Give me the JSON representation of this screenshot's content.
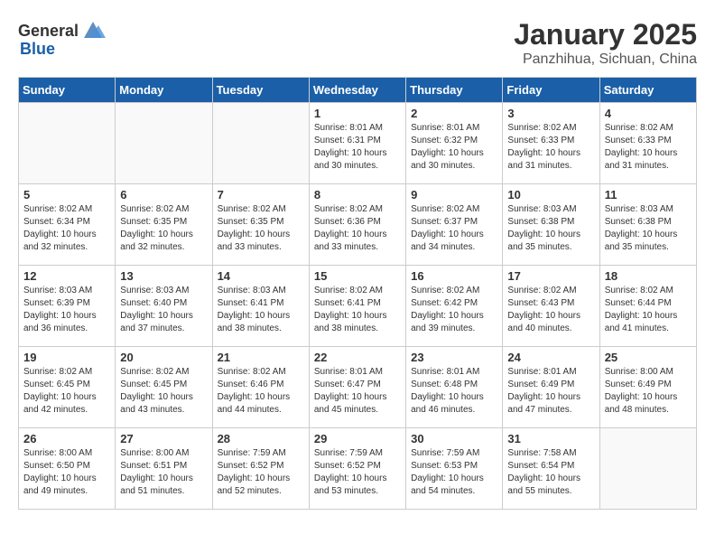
{
  "header": {
    "logo_general": "General",
    "logo_blue": "Blue",
    "title": "January 2025",
    "subtitle": "Panzhihua, Sichuan, China"
  },
  "weekdays": [
    "Sunday",
    "Monday",
    "Tuesday",
    "Wednesday",
    "Thursday",
    "Friday",
    "Saturday"
  ],
  "weeks": [
    [
      {
        "day": "",
        "info": ""
      },
      {
        "day": "",
        "info": ""
      },
      {
        "day": "",
        "info": ""
      },
      {
        "day": "1",
        "info": "Sunrise: 8:01 AM\nSunset: 6:31 PM\nDaylight: 10 hours\nand 30 minutes."
      },
      {
        "day": "2",
        "info": "Sunrise: 8:01 AM\nSunset: 6:32 PM\nDaylight: 10 hours\nand 30 minutes."
      },
      {
        "day": "3",
        "info": "Sunrise: 8:02 AM\nSunset: 6:33 PM\nDaylight: 10 hours\nand 31 minutes."
      },
      {
        "day": "4",
        "info": "Sunrise: 8:02 AM\nSunset: 6:33 PM\nDaylight: 10 hours\nand 31 minutes."
      }
    ],
    [
      {
        "day": "5",
        "info": "Sunrise: 8:02 AM\nSunset: 6:34 PM\nDaylight: 10 hours\nand 32 minutes."
      },
      {
        "day": "6",
        "info": "Sunrise: 8:02 AM\nSunset: 6:35 PM\nDaylight: 10 hours\nand 32 minutes."
      },
      {
        "day": "7",
        "info": "Sunrise: 8:02 AM\nSunset: 6:35 PM\nDaylight: 10 hours\nand 33 minutes."
      },
      {
        "day": "8",
        "info": "Sunrise: 8:02 AM\nSunset: 6:36 PM\nDaylight: 10 hours\nand 33 minutes."
      },
      {
        "day": "9",
        "info": "Sunrise: 8:02 AM\nSunset: 6:37 PM\nDaylight: 10 hours\nand 34 minutes."
      },
      {
        "day": "10",
        "info": "Sunrise: 8:03 AM\nSunset: 6:38 PM\nDaylight: 10 hours\nand 35 minutes."
      },
      {
        "day": "11",
        "info": "Sunrise: 8:03 AM\nSunset: 6:38 PM\nDaylight: 10 hours\nand 35 minutes."
      }
    ],
    [
      {
        "day": "12",
        "info": "Sunrise: 8:03 AM\nSunset: 6:39 PM\nDaylight: 10 hours\nand 36 minutes."
      },
      {
        "day": "13",
        "info": "Sunrise: 8:03 AM\nSunset: 6:40 PM\nDaylight: 10 hours\nand 37 minutes."
      },
      {
        "day": "14",
        "info": "Sunrise: 8:03 AM\nSunset: 6:41 PM\nDaylight: 10 hours\nand 38 minutes."
      },
      {
        "day": "15",
        "info": "Sunrise: 8:02 AM\nSunset: 6:41 PM\nDaylight: 10 hours\nand 38 minutes."
      },
      {
        "day": "16",
        "info": "Sunrise: 8:02 AM\nSunset: 6:42 PM\nDaylight: 10 hours\nand 39 minutes."
      },
      {
        "day": "17",
        "info": "Sunrise: 8:02 AM\nSunset: 6:43 PM\nDaylight: 10 hours\nand 40 minutes."
      },
      {
        "day": "18",
        "info": "Sunrise: 8:02 AM\nSunset: 6:44 PM\nDaylight: 10 hours\nand 41 minutes."
      }
    ],
    [
      {
        "day": "19",
        "info": "Sunrise: 8:02 AM\nSunset: 6:45 PM\nDaylight: 10 hours\nand 42 minutes."
      },
      {
        "day": "20",
        "info": "Sunrise: 8:02 AM\nSunset: 6:45 PM\nDaylight: 10 hours\nand 43 minutes."
      },
      {
        "day": "21",
        "info": "Sunrise: 8:02 AM\nSunset: 6:46 PM\nDaylight: 10 hours\nand 44 minutes."
      },
      {
        "day": "22",
        "info": "Sunrise: 8:01 AM\nSunset: 6:47 PM\nDaylight: 10 hours\nand 45 minutes."
      },
      {
        "day": "23",
        "info": "Sunrise: 8:01 AM\nSunset: 6:48 PM\nDaylight: 10 hours\nand 46 minutes."
      },
      {
        "day": "24",
        "info": "Sunrise: 8:01 AM\nSunset: 6:49 PM\nDaylight: 10 hours\nand 47 minutes."
      },
      {
        "day": "25",
        "info": "Sunrise: 8:00 AM\nSunset: 6:49 PM\nDaylight: 10 hours\nand 48 minutes."
      }
    ],
    [
      {
        "day": "26",
        "info": "Sunrise: 8:00 AM\nSunset: 6:50 PM\nDaylight: 10 hours\nand 49 minutes."
      },
      {
        "day": "27",
        "info": "Sunrise: 8:00 AM\nSunset: 6:51 PM\nDaylight: 10 hours\nand 51 minutes."
      },
      {
        "day": "28",
        "info": "Sunrise: 7:59 AM\nSunset: 6:52 PM\nDaylight: 10 hours\nand 52 minutes."
      },
      {
        "day": "29",
        "info": "Sunrise: 7:59 AM\nSunset: 6:52 PM\nDaylight: 10 hours\nand 53 minutes."
      },
      {
        "day": "30",
        "info": "Sunrise: 7:59 AM\nSunset: 6:53 PM\nDaylight: 10 hours\nand 54 minutes."
      },
      {
        "day": "31",
        "info": "Sunrise: 7:58 AM\nSunset: 6:54 PM\nDaylight: 10 hours\nand 55 minutes."
      },
      {
        "day": "",
        "info": ""
      }
    ]
  ]
}
